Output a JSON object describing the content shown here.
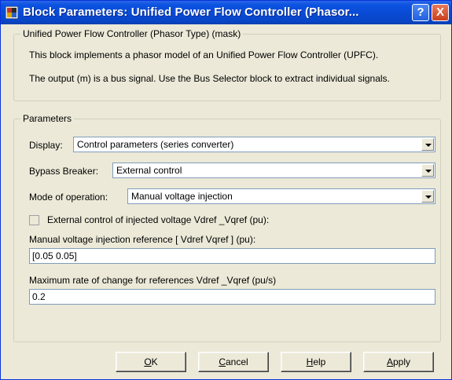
{
  "window": {
    "title": "Block Parameters: Unified Power Flow Controller (Phasor...",
    "help_button": "?",
    "close_button": "X"
  },
  "mask": {
    "legend": "Unified Power Flow Controller (Phasor Type) (mask)",
    "line1": "This block implements a phasor model of an Unified Power Flow Controller (UPFC).",
    "line2": "The output (m) is a bus signal. Use the Bus Selector block to extract individual signals."
  },
  "params": {
    "legend": "Parameters",
    "display_label": "Display:",
    "display_value": "Control parameters (series converter)",
    "bypass_label": "Bypass Breaker:",
    "bypass_value": "External control",
    "mode_label": "Mode of operation:",
    "mode_value": "Manual voltage injection",
    "ext_control_label": "External control of injected voltage Vdref _Vqref (pu):",
    "ext_control_checked": false,
    "manual_ref_label": "Manual voltage injection reference [ Vdref  Vqref ] (pu):",
    "manual_ref_value": "[0.05 0.05]",
    "max_rate_label": "Maximum rate of change for references Vdref _Vqref (pu/s)",
    "max_rate_value": "0.2"
  },
  "buttons": {
    "ok_acc": "O",
    "ok_rest": "K",
    "cancel_acc": "C",
    "cancel_rest": "ancel",
    "help_acc": "H",
    "help_rest": "elp",
    "apply_acc": "A",
    "apply_rest": "pply"
  },
  "icons": {
    "app": "simulink-block-icon",
    "dropdown": "chevron-down-icon"
  },
  "colors": {
    "titlebar": "#0a4bd6",
    "dialog_bg": "#ece9d8",
    "field_border": "#7f9db9"
  }
}
